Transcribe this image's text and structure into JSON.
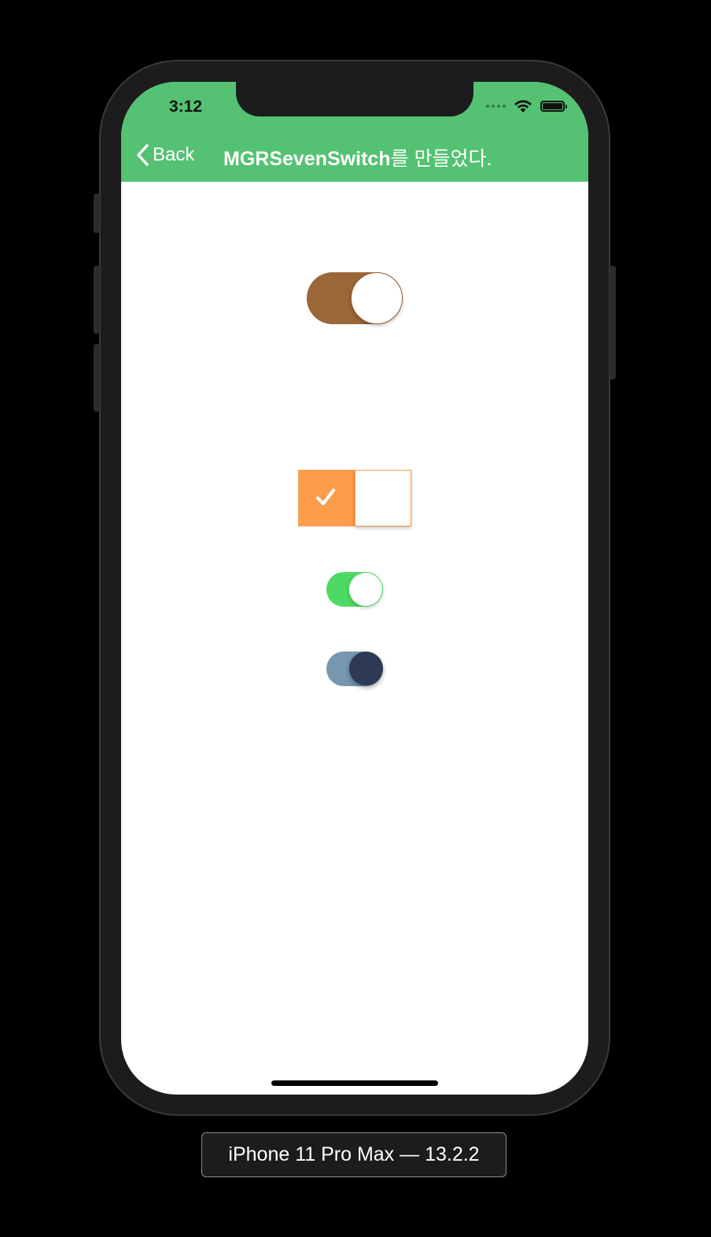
{
  "status_bar": {
    "time": "3:12",
    "icons": [
      "cellular-dots-icon",
      "wifi-icon",
      "battery-icon"
    ]
  },
  "navbar": {
    "background": "#54c272",
    "back_label": "Back",
    "title_latin": "MGRSevenSwitch",
    "title_korean": "를 만들었다."
  },
  "switches": [
    {
      "name": "brown-switch",
      "state": "on",
      "style": "rounded",
      "on_color": "#9b6638",
      "thumb_color": "#ffffff"
    },
    {
      "name": "orange-square-switch",
      "state": "on",
      "style": "square",
      "on_color": "#fc9d4b",
      "thumb_color": "#ffffff",
      "icon": "checkmark-icon"
    },
    {
      "name": "green-switch",
      "state": "on",
      "style": "rounded",
      "on_color": "#4cd964",
      "thumb_color": "#ffffff"
    },
    {
      "name": "navy-switch",
      "state": "on",
      "style": "rounded",
      "on_color": "#7597af",
      "thumb_color": "#2e3a55"
    }
  ],
  "simulator": {
    "device_label": "iPhone 11 Pro Max — 13.2.2"
  }
}
